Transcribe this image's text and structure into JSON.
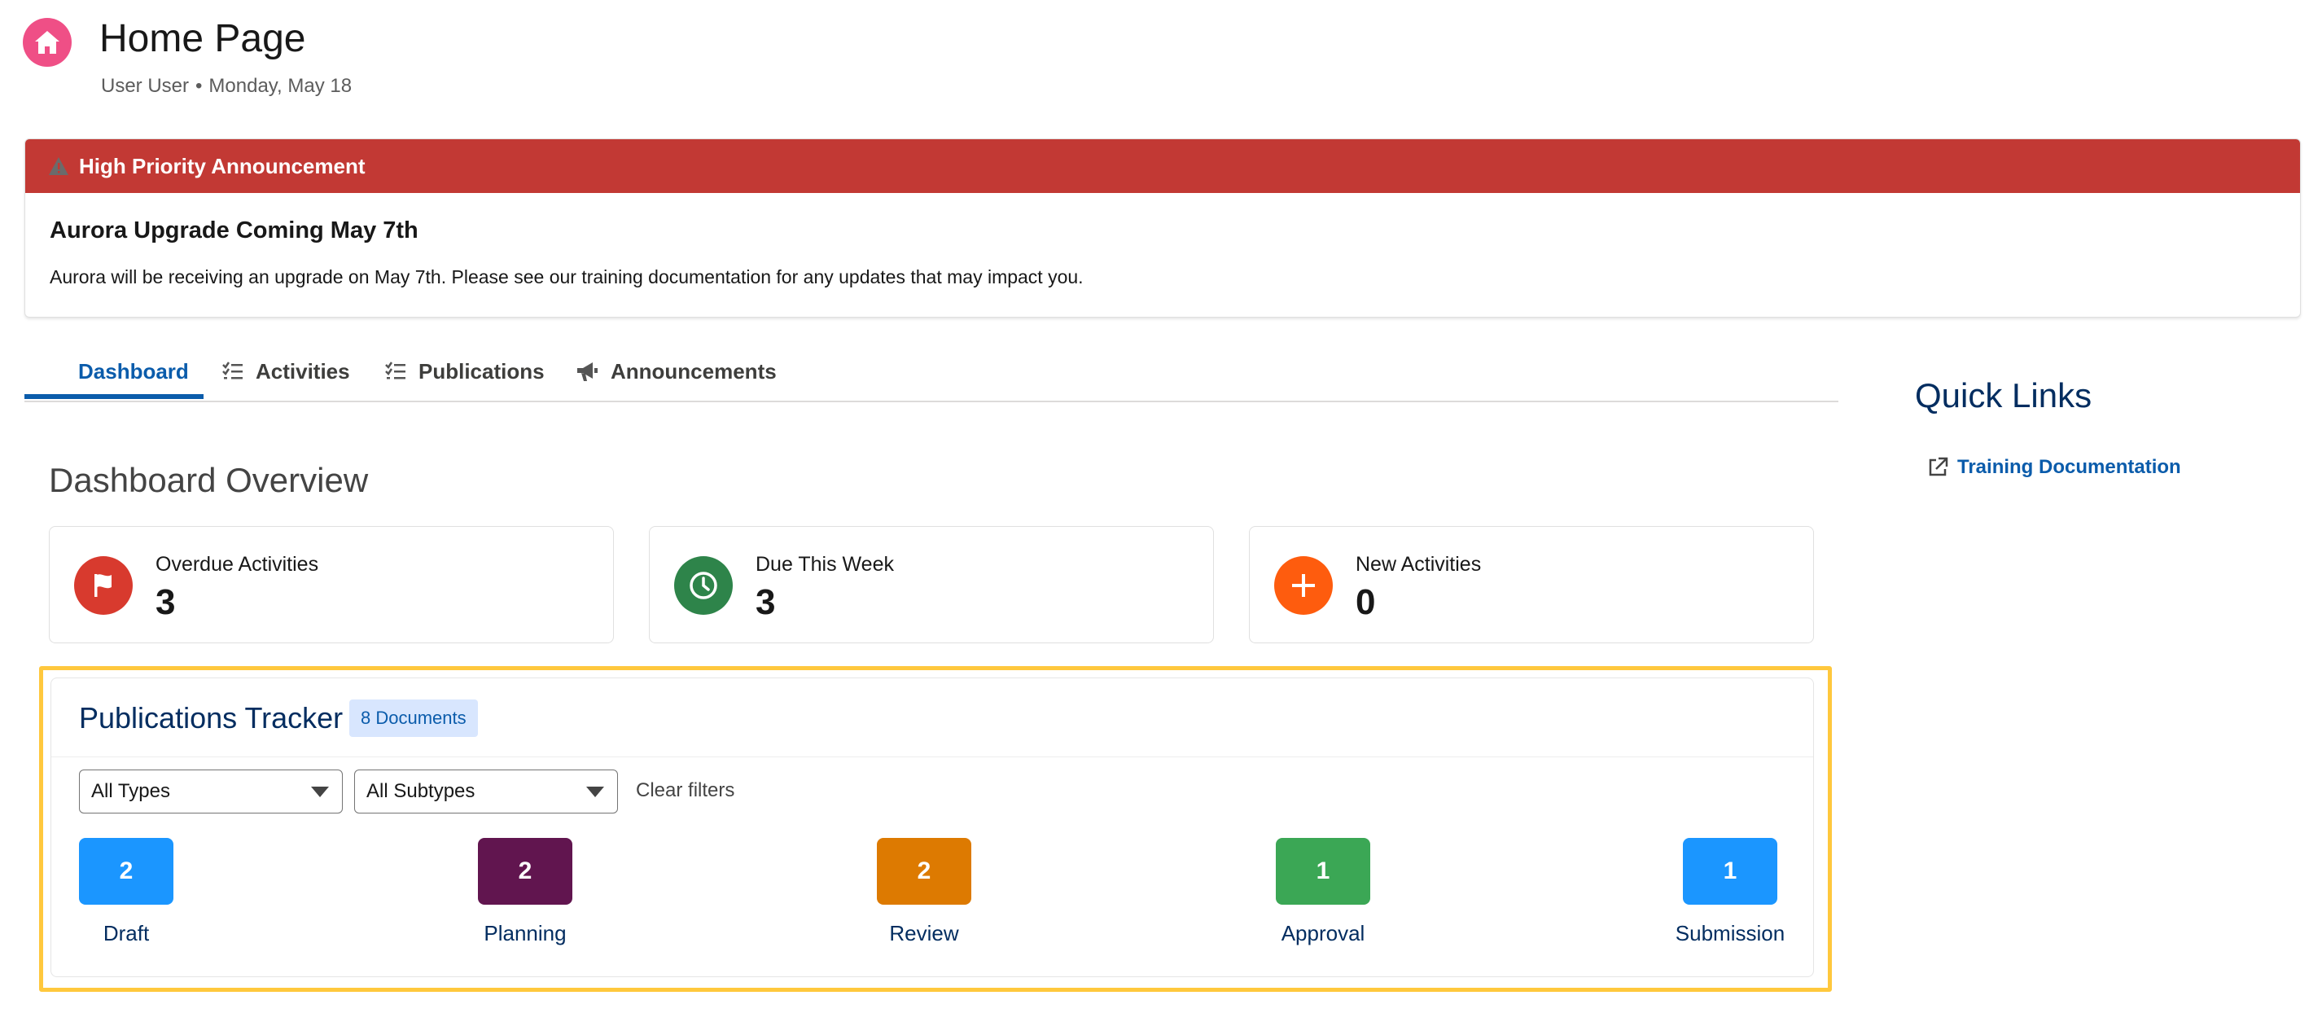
{
  "header": {
    "title": "Home Page",
    "user": "User User",
    "separator": "•",
    "date": "Monday, May 18",
    "icon": "home-icon"
  },
  "announcement": {
    "banner_label": "High Priority Announcement",
    "title": "Aurora Upgrade Coming May 7th",
    "body": "Aurora will be receiving an upgrade on May 7th. Please see our training documentation for any updates that may impact you.",
    "color": "#c23934"
  },
  "tabs": [
    {
      "label": "Dashboard",
      "active": true
    },
    {
      "label": "Activities",
      "icon": "checklist-icon"
    },
    {
      "label": "Publications",
      "icon": "checklist-icon"
    },
    {
      "label": "Announcements",
      "icon": "megaphone-icon"
    }
  ],
  "quick_links": {
    "title": "Quick Links",
    "items": [
      {
        "label": "Training Documentation",
        "icon": "external-link-icon"
      }
    ]
  },
  "dashboard": {
    "title": "Dashboard Overview",
    "cards": [
      {
        "label": "Overdue Activities",
        "value": "3",
        "color": "#d83a2e",
        "icon": "flag-icon"
      },
      {
        "label": "Due This Week",
        "value": "3",
        "color": "#2e844a",
        "icon": "clock-icon"
      },
      {
        "label": "New Activities",
        "value": "0",
        "color": "#fe5c0e",
        "icon": "plus-icon"
      }
    ]
  },
  "tracker": {
    "title": "Publications Tracker",
    "badge": "8 Documents",
    "filters": {
      "type": "All Types",
      "subtype": "All Subtypes",
      "clear": "Clear filters"
    },
    "stages": [
      {
        "name": "Draft",
        "count": "2",
        "color": "#1b96ff"
      },
      {
        "name": "Planning",
        "count": "2",
        "color": "#61154f"
      },
      {
        "name": "Review",
        "count": "2",
        "color": "#dd7a01"
      },
      {
        "name": "Approval",
        "count": "1",
        "color": "#3ba755"
      },
      {
        "name": "Submission",
        "count": "1",
        "color": "#1b96ff"
      }
    ]
  }
}
